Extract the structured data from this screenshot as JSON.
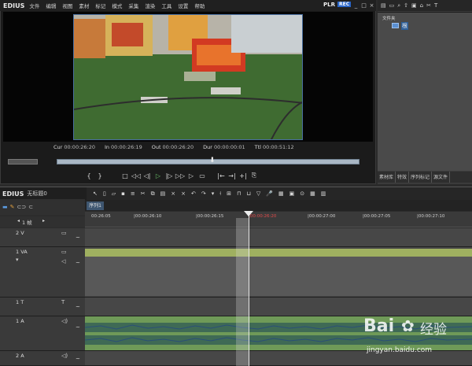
{
  "app": {
    "logo": "EDIUS"
  },
  "menu": [
    "文件",
    "编辑",
    "视图",
    "素材",
    "标记",
    "模式",
    "采集",
    "渲染",
    "工具",
    "设置",
    "帮助"
  ],
  "player": {
    "mode_plr": "PLR",
    "mode_rec": "REC",
    "timecodes": [
      {
        "label": "Cur",
        "value": "00:00:26:20"
      },
      {
        "label": "In",
        "value": "00:00:26:19"
      },
      {
        "label": "Out",
        "value": "00:00:26:20"
      },
      {
        "label": "Dur",
        "value": "00:00:00:01"
      },
      {
        "label": "Ttl",
        "value": "00:00:51:12"
      }
    ]
  },
  "bin": {
    "folder_label": "文件夹",
    "root_label": "根",
    "tabs": [
      "素材库",
      "特效",
      "序列标记",
      "源文件"
    ]
  },
  "timeline": {
    "project_name": "无标题0",
    "sequence_tab": "序列1",
    "ruler_ticks": [
      {
        "label": "00:26:05"
      },
      {
        "label": "|00:00:26:10"
      },
      {
        "label": "|00:00:26:15"
      },
      {
        "label": "|00:00:26:20",
        "red": true
      },
      {
        "label": "|00:00:27:00"
      },
      {
        "label": "|00:00:27:05"
      },
      {
        "label": "|00:00:27:10"
      }
    ],
    "ruler_scale": "1 帧",
    "tracks": [
      {
        "name": "2 V",
        "type": "video"
      },
      {
        "name": "1 VA",
        "type": "videoaudio"
      },
      {
        "name": "1 T",
        "type": "title"
      },
      {
        "name": "1 A",
        "type": "audio"
      },
      {
        "name": "2 A",
        "type": "audio"
      }
    ]
  },
  "watermark": {
    "brand": "Bai",
    "brand_cn": "经验",
    "url": "jingyan.baidu.com"
  },
  "colors": {
    "accent_blue": "#2a66c8",
    "track_video_clip": "#8fa86a",
    "track_audio_clip": "#6f9a58",
    "playhead": "#e24b4b"
  }
}
